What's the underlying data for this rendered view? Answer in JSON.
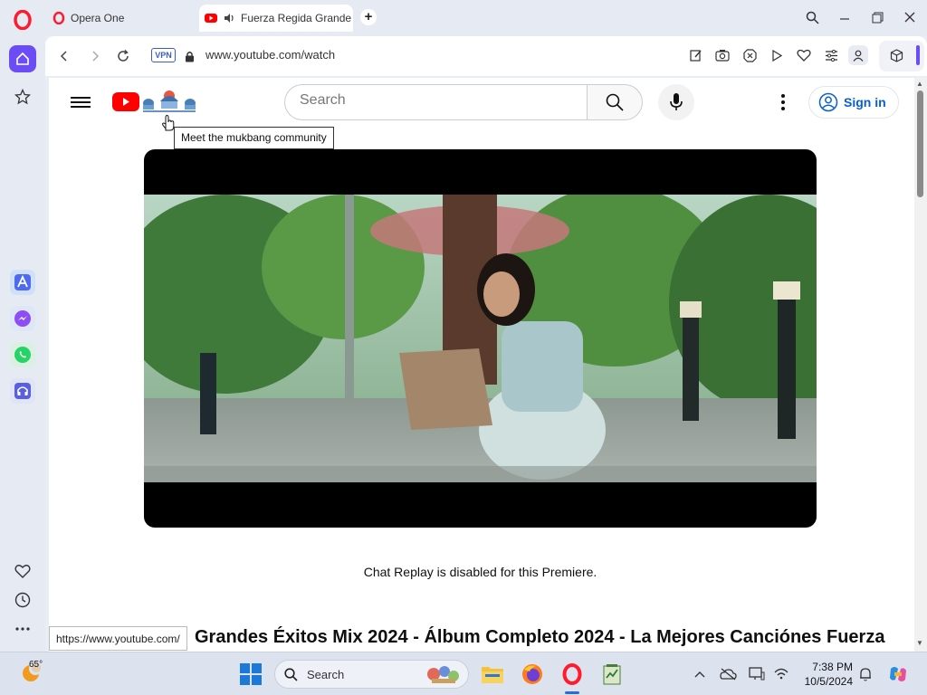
{
  "browser": {
    "tabs": [
      {
        "label": "Opera One",
        "active": false
      },
      {
        "label": "Fuerza Regida Grande",
        "active": true
      }
    ],
    "new_tab": "+",
    "vpn_label": "VPN",
    "url": "www.youtube.com/watch",
    "accent_color": "#6c4cf5"
  },
  "youtube": {
    "search_placeholder": "Search",
    "sign_in_label": "Sign in",
    "doodle_tooltip": "Meet the mukbang community",
    "chat_replay_notice": "Chat Replay is disabled for this Premiere.",
    "video_title": "Grandes Éxitos Mix 2024 - Álbum Completo 2024 - La Mejores Canciónes Fuerza",
    "brand_color": "#ff0000",
    "link_color": "#065fd4"
  },
  "status_url": "https://www.youtube.com/",
  "taskbar": {
    "weather_temp": "65°",
    "search_label": "Search",
    "time": "7:38 PM",
    "date": "10/5/2024"
  }
}
